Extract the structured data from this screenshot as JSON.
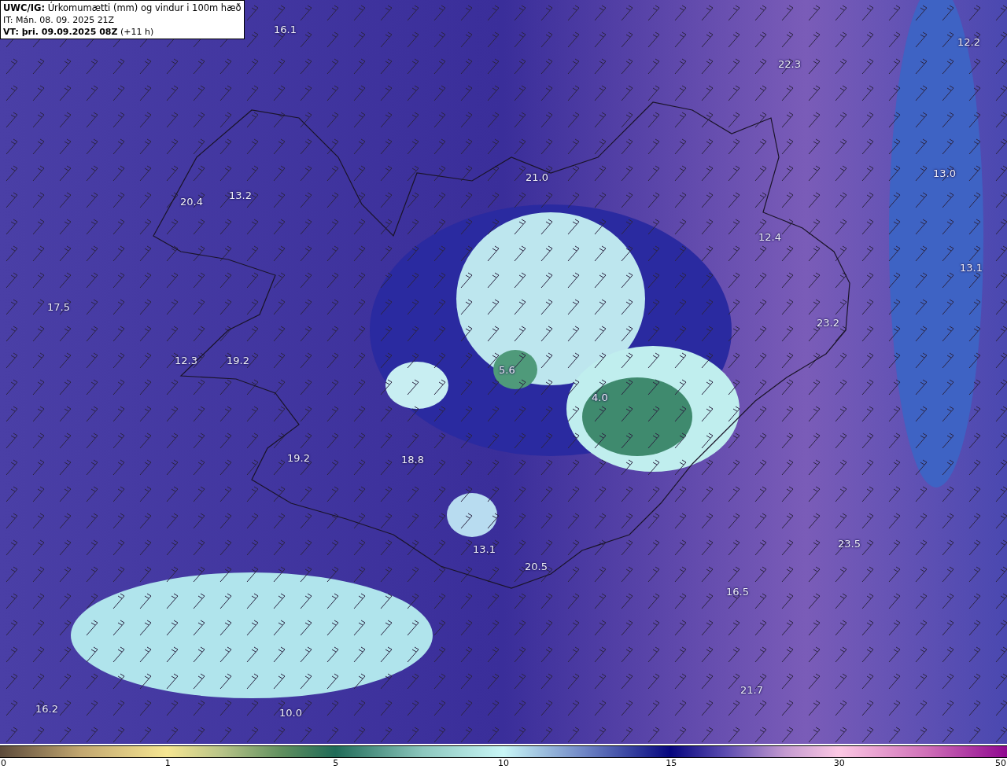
{
  "header": {
    "lines": [
      "**UWC/IG:** Úrkomumætti (mm) og vindur i 100m hæð",
      "IT: Mán. 08. 09. 2025 21Z",
      "**VT: þri. 09.09.2025 08Z** (+11 h)"
    ]
  },
  "map_labels": [
    "16.1",
    "22.3",
    "12.2",
    "21.0",
    "13.0",
    "20.4",
    "13.2",
    "12.4",
    "13.1",
    "17.5",
    "23.2",
    "12.3",
    "19.2",
    "5.6",
    "4.0",
    "19.2",
    "18.8",
    "23.5",
    "13.1",
    "20.5",
    "16.5",
    "21.7",
    "16.2",
    "10.0"
  ],
  "colorbar": {
    "ticks": [
      "0",
      "1",
      "5",
      "10",
      "15",
      "30",
      "50"
    ]
  }
}
